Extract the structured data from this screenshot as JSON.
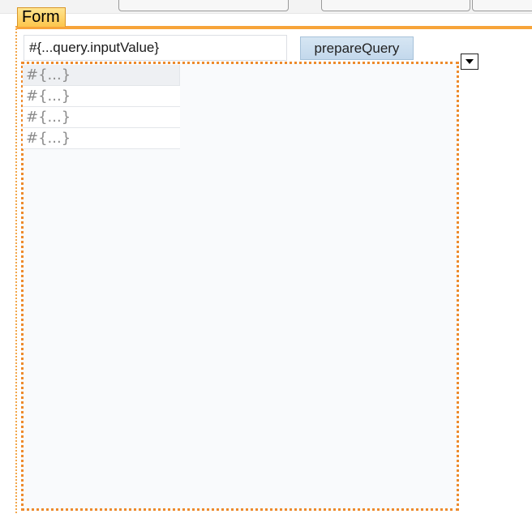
{
  "form": {
    "tab_label": "Form"
  },
  "query": {
    "input_value": "#{...query.inputValue}"
  },
  "actions": {
    "prepare_label": "prepareQuery"
  },
  "table": {
    "rows": [
      {
        "text": "#{...}"
      },
      {
        "text": "#{...}"
      },
      {
        "text": "#{...}"
      },
      {
        "text": "#{...}"
      }
    ]
  },
  "icons": {
    "dropdown": "chevron-down-icon"
  },
  "colors": {
    "accent_orange": "#f7a43a",
    "selection_border": "#ee8a2c",
    "button_blue": "#c3d8ec"
  }
}
